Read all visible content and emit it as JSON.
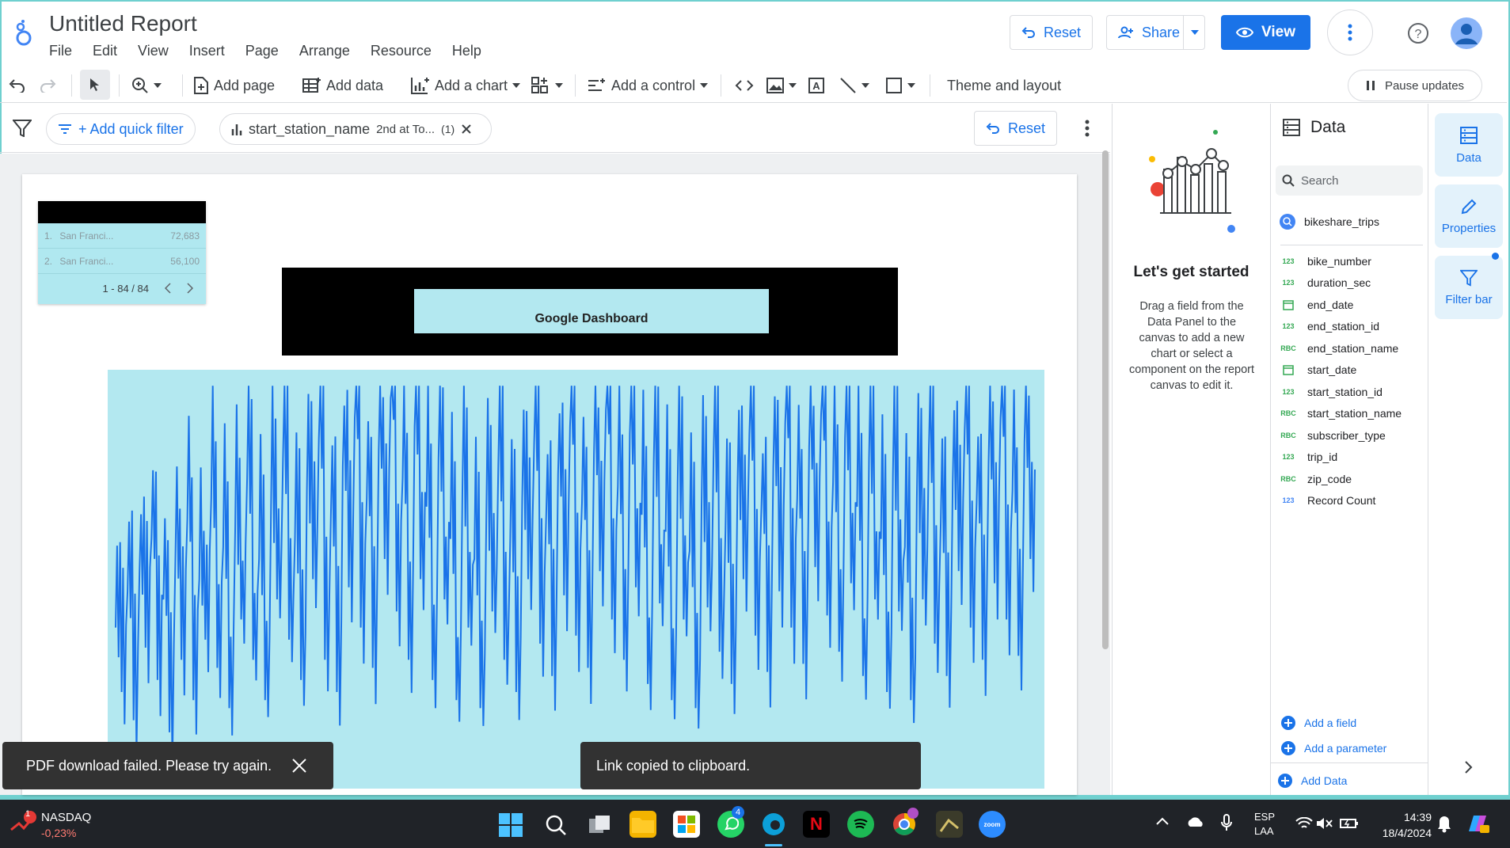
{
  "header": {
    "title": "Untitled Report",
    "menu": [
      "File",
      "Edit",
      "View",
      "Insert",
      "Page",
      "Arrange",
      "Resource",
      "Help"
    ],
    "reset_label": "Reset",
    "share_label": "Share",
    "view_label": "View"
  },
  "toolbar": {
    "add_page": "Add page",
    "add_data": "Add data",
    "add_chart": "Add a chart",
    "add_control": "Add a control",
    "theme_layout": "Theme and layout",
    "pause_updates": "Pause updates"
  },
  "filter_bar": {
    "add_quick_filter": "+ Add quick filter",
    "chip_field": "start_station_name",
    "chip_value": "2nd at To...",
    "chip_count": "(1)",
    "reset_label": "Reset"
  },
  "canvas": {
    "table_rows": [
      {
        "idx": "1.",
        "name": "San Franci...",
        "value": "72,683"
      },
      {
        "idx": "2.",
        "name": "San Franci...",
        "value": "56,100"
      }
    ],
    "table_pager": "1 - 84 / 84",
    "banner_text": "Google Dashboard"
  },
  "chart_data": {
    "type": "line",
    "title": "",
    "xlabel": "",
    "ylabel": "",
    "series_color": "#1a73e8",
    "background": "#b3e8f0",
    "note_values_relative": [
      0.38,
      0.22,
      0.47,
      0.15,
      0.52,
      0.33,
      0.6,
      0.25,
      0.45,
      0.12,
      0.55,
      0.3,
      0.65,
      0.2,
      0.5,
      0.35,
      0.7,
      0.28,
      0.58,
      0.18,
      0.62,
      0.4,
      0.75,
      0.3,
      0.55,
      0.2,
      0.68,
      0.45,
      0.8,
      0.35,
      0.6,
      0.25,
      0.72,
      0.5,
      0.85,
      0.3,
      0.65,
      0.22,
      0.78,
      0.48,
      0.9,
      0.38,
      0.7,
      0.28,
      0.82,
      0.55,
      0.95,
      0.42,
      0.75,
      0.3,
      0.88,
      0.5,
      0.68,
      0.25,
      0.8,
      0.45,
      0.6,
      0.2,
      0.72,
      0.38,
      0.55,
      0.18,
      0.66,
      0.42,
      0.78,
      0.3,
      0.6,
      0.22,
      0.7,
      0.5,
      0.84,
      0.34,
      0.65,
      0.26,
      0.76,
      0.46,
      0.88,
      0.36,
      0.69,
      0.28,
      0.81,
      0.52,
      0.92,
      0.4,
      0.73,
      0.3,
      0.86,
      0.48,
      0.66,
      0.24,
      0.79,
      0.44,
      0.62,
      0.2,
      0.74,
      0.4,
      0.57,
      0.18,
      0.68,
      0.43,
      0.8,
      0.32,
      0.62,
      0.24,
      0.72,
      0.5,
      0.86,
      0.36,
      0.67,
      0.27,
      0.78,
      0.47,
      0.89,
      0.38,
      0.7,
      0.29,
      0.83,
      0.53,
      0.91,
      0.41,
      0.74,
      0.32,
      0.85,
      0.49,
      0.68,
      0.26,
      0.8,
      0.45,
      0.6,
      0.22,
      0.76,
      0.42,
      0.58,
      0.2,
      0.7,
      0.45,
      0.82,
      0.34,
      0.64,
      0.26,
      0.74,
      0.52,
      0.87,
      0.38,
      0.69,
      0.3,
      0.79,
      0.49,
      0.9,
      0.4,
      0.72,
      0.31,
      0.84,
      0.55
    ]
  },
  "lets_get_started": {
    "title": "Let's get started",
    "body": "Drag a field from the Data Panel to the canvas to add a new chart or select a component on the report canvas to edit it."
  },
  "data_panel": {
    "title": "Data",
    "search_placeholder": "Search",
    "datasource": "bikeshare_trips",
    "fields": [
      {
        "type": "123",
        "name": "bike_number"
      },
      {
        "type": "123",
        "name": "duration_sec"
      },
      {
        "type": "date",
        "name": "end_date"
      },
      {
        "type": "123",
        "name": "end_station_id"
      },
      {
        "type": "ABC",
        "name": "end_station_name"
      },
      {
        "type": "date",
        "name": "start_date"
      },
      {
        "type": "123",
        "name": "start_station_id"
      },
      {
        "type": "ABC",
        "name": "start_station_name"
      },
      {
        "type": "ABC",
        "name": "subscriber_type"
      },
      {
        "type": "123",
        "name": "trip_id"
      },
      {
        "type": "ABC",
        "name": "zip_code"
      },
      {
        "type": "123",
        "name": "Record Count"
      }
    ],
    "add_field": "Add a field",
    "add_parameter": "Add a parameter",
    "add_data": "Add Data"
  },
  "rail": {
    "data": "Data",
    "properties": "Properties",
    "filter_bar": "Filter bar"
  },
  "toasts": {
    "pdf_failed": "PDF download failed. Please try again.",
    "link_copied": "Link copied to clipboard."
  },
  "taskbar": {
    "stock_name": "NASDAQ",
    "stock_change": "-0,23%",
    "stock_badge": "1",
    "whatsapp_badge": "4",
    "lang_1": "ESP",
    "lang_2": "LAA",
    "time": "14:39",
    "date": "18/4/2024"
  }
}
